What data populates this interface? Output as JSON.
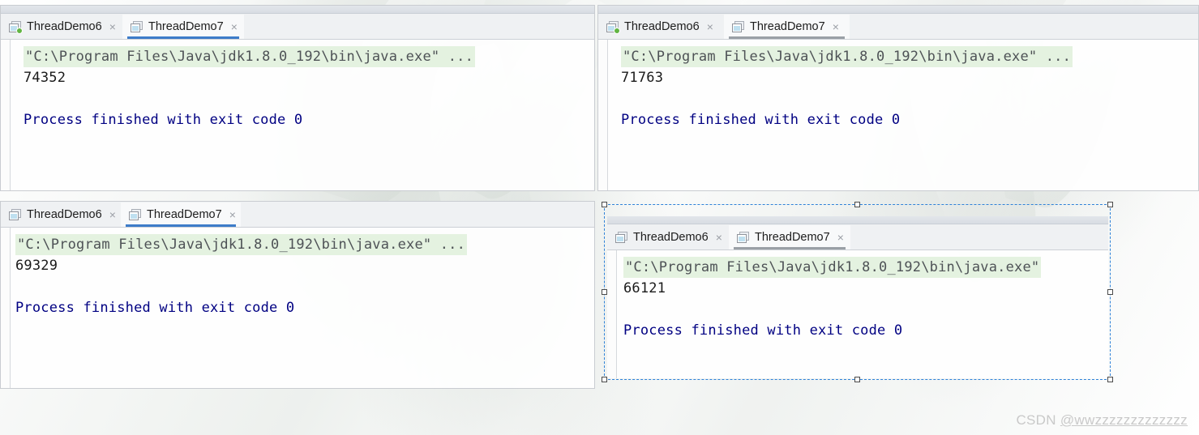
{
  "watermark": {
    "brand": "CSDN ",
    "user": "@wwzzzzzzzzzzzzz"
  },
  "console_common": {
    "command_line": "\"C:\\Program Files\\Java\\jdk1.8.0_192\\bin\\java.exe\" ...",
    "command_line_clipped": "\"C:\\Program Files\\Java\\jdk1.8.0_192\\bin\\java.exe\"",
    "blank_line": "",
    "exit_line": "Process finished with exit code 0",
    "close_glyph": "×",
    "highlight_color": "#e4f2e0",
    "exit_color": "#000082",
    "running_dot_color": "#62b543",
    "active_tab_underline_color": "#3d7cc9",
    "inactive_underline_color": "#9aa0a6",
    "selection_color": "#2f82d8"
  },
  "panels": [
    {
      "id": "panel-top-left",
      "tabs": [
        {
          "label": "ThreadDemo6",
          "active": false,
          "running": true,
          "icon": "console-window-icon"
        },
        {
          "label": "ThreadDemo7",
          "active": true,
          "running": false,
          "icon": "console-window-icon"
        }
      ],
      "underline_style": "blue",
      "output": {
        "command": "\"C:\\Program Files\\Java\\jdk1.8.0_192\\bin\\java.exe\" ...",
        "value": "74352",
        "exit": "Process finished with exit code 0"
      }
    },
    {
      "id": "panel-top-right",
      "tabs": [
        {
          "label": "ThreadDemo6",
          "active": false,
          "running": true,
          "icon": "console-window-icon"
        },
        {
          "label": "ThreadDemo7",
          "active": true,
          "running": false,
          "icon": "console-window-icon"
        }
      ],
      "underline_style": "gray",
      "output": {
        "command": "\"C:\\Program Files\\Java\\jdk1.8.0_192\\bin\\java.exe\" ...",
        "value": "71763",
        "exit": "Process finished with exit code 0"
      }
    },
    {
      "id": "panel-bottom-left",
      "tabs": [
        {
          "label": "ThreadDemo6",
          "active": false,
          "running": false,
          "icon": "console-window-icon"
        },
        {
          "label": "ThreadDemo7",
          "active": true,
          "running": false,
          "icon": "console-window-icon"
        }
      ],
      "underline_style": "blue",
      "output": {
        "command": "\"C:\\Program Files\\Java\\jdk1.8.0_192\\bin\\java.exe\" ...",
        "value": "69329",
        "exit": "Process finished with exit code 0"
      }
    },
    {
      "id": "panel-bottom-right",
      "selected": true,
      "tabs": [
        {
          "label": "ThreadDemo6",
          "active": false,
          "running": false,
          "icon": "console-window-icon"
        },
        {
          "label": "ThreadDemo7",
          "active": true,
          "running": false,
          "icon": "console-window-icon"
        }
      ],
      "underline_style": "gray",
      "output": {
        "command": "\"C:\\Program Files\\Java\\jdk1.8.0_192\\bin\\java.exe\"",
        "value": "66121",
        "exit": "Process finished with exit code 0"
      }
    }
  ]
}
